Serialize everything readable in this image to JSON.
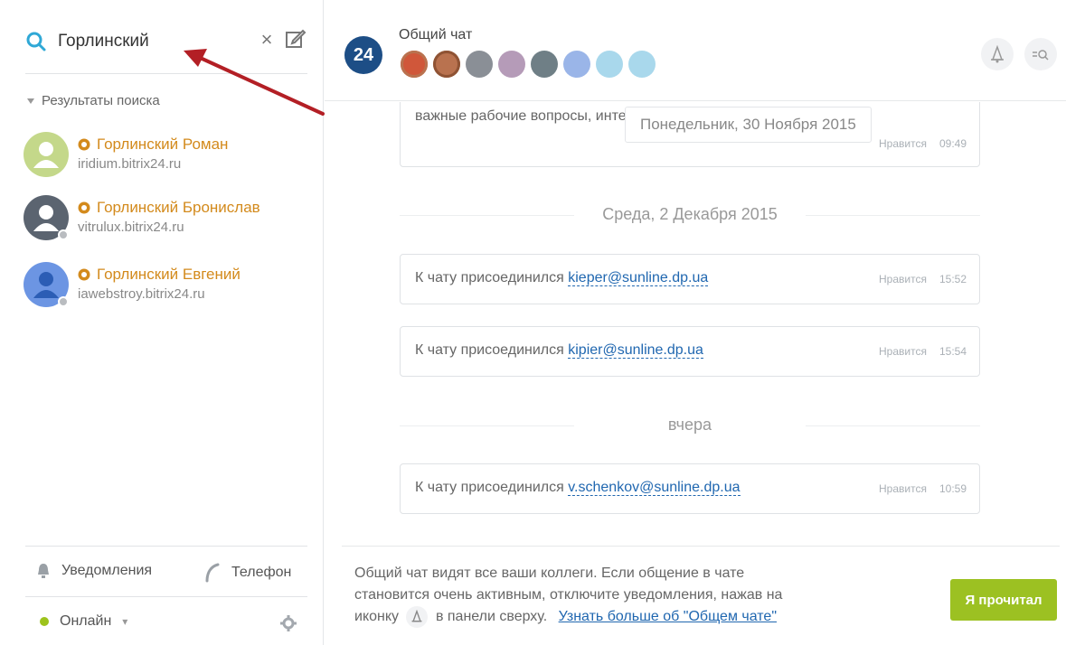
{
  "sidebar": {
    "search": {
      "value": "Горлинский",
      "placeholder": ""
    },
    "results_header": "Результаты поиска",
    "contacts": [
      {
        "name": "Горлинский Роман",
        "domain": "iridium.bitrix24.ru",
        "avatar_color": "#c4d88a"
      },
      {
        "name": "Горлинский Бронислав",
        "domain": "vitrulux.bitrix24.ru",
        "avatar_color": "#5b6470"
      },
      {
        "name": "Горлинский Евгений",
        "domain": "iawebstroy.bitrix24.ru",
        "avatar_color": "#6c95e3"
      }
    ],
    "footer": {
      "notifications": "Уведомления",
      "phone": "Телефон",
      "status": "Онлайн"
    }
  },
  "chat": {
    "logo_text": "24",
    "title": "Общий чат",
    "members": [
      {
        "color": "#d0573a"
      },
      {
        "color": "#b9724f"
      },
      {
        "color": "#8a8f96"
      },
      {
        "color": "#b59bb8"
      },
      {
        "color": "#6f7f86"
      },
      {
        "color": "#9ab5e8"
      },
      {
        "color": "#a9d8ec"
      },
      {
        "color": "#a9d8ec"
      }
    ],
    "top_message_fragment": "важные рабочие вопросы, интересные всей компании.",
    "top_date": "Понедельник, 30 Ноября 2015",
    "top_meta": {
      "like": "Нравится",
      "time": "09:49"
    },
    "date_1": "Среда, 2 Декабря 2015",
    "date_2": "вчера",
    "messages": [
      {
        "prefix": "К чату присоединился",
        "user": "kieper@sunline.dp.ua",
        "like": "Нравится",
        "time": "15:52"
      },
      {
        "prefix": "К чату присоединился",
        "user": "kipier@sunline.dp.ua",
        "like": "Нравится",
        "time": "15:54"
      },
      {
        "prefix": "К чату присоединился",
        "user": "v.schenkov@sunline.dp.ua",
        "like": "Нравится",
        "time": "10:59"
      }
    ],
    "notice": {
      "line1": "Общий чат видят все ваши коллеги. Если общение в чате",
      "line2": "становится очень активным, отключите уведомления, нажав на",
      "line3_before": "иконку",
      "line3_after": "в панели сверху.",
      "link": "Узнать больше об \"Общем чате\""
    },
    "read_button": "Я прочитал"
  },
  "colors": {
    "accent_green": "#9cc122",
    "link_blue": "#2067b0",
    "name_orange": "#d38a1c",
    "logo_blue": "#1d4e86"
  }
}
